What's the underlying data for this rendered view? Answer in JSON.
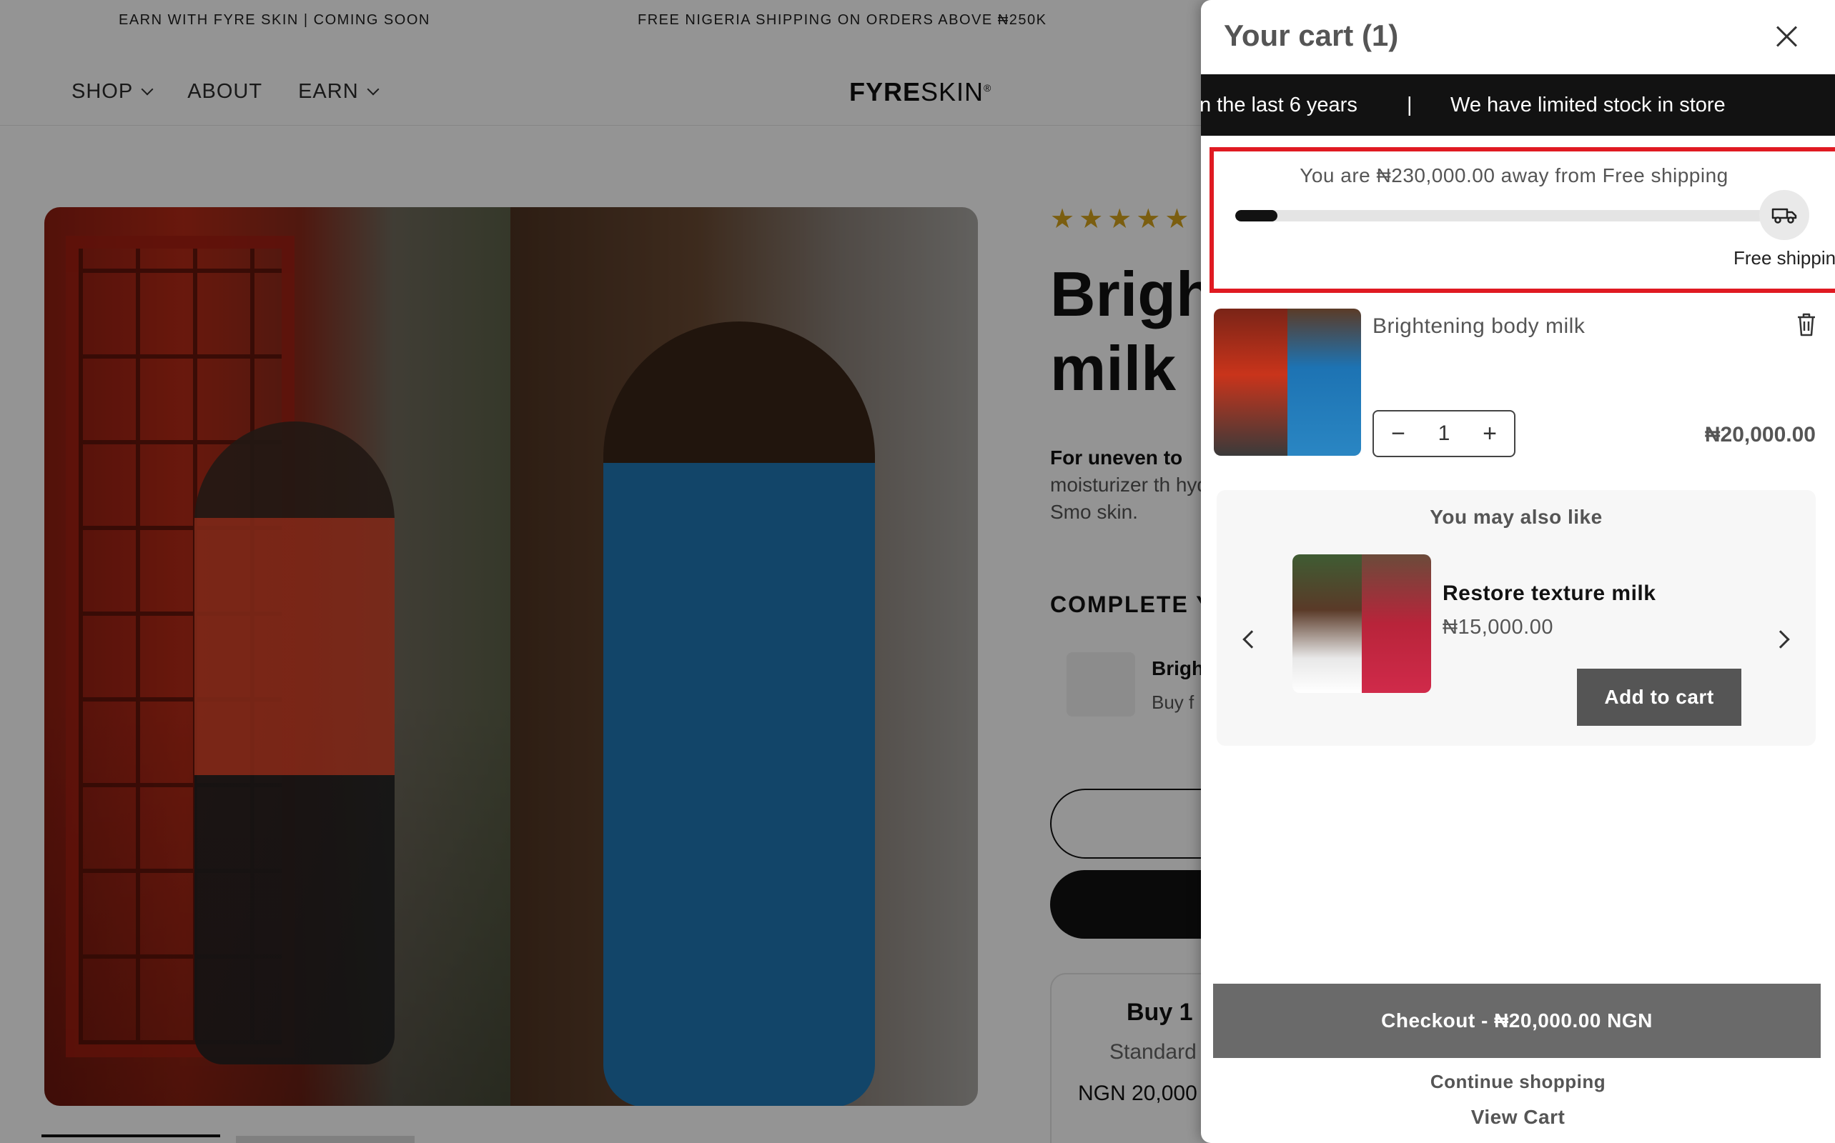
{
  "announcement": {
    "left": "EARN WITH FYRE SKIN | COMING SOON",
    "center": "FREE NIGERIA SHIPPING ON ORDERS ABOVE ₦250K"
  },
  "header": {
    "nav": [
      "SHOP",
      "ABOUT",
      "EARN"
    ],
    "logo_bold": "FYRE",
    "logo_light": "SKIN",
    "logo_mark": "®"
  },
  "product": {
    "title_line1": "Brigh",
    "title_line2": "milk",
    "desc_bold": "For uneven to",
    "desc_rest": "moisturizer th hydrates. Smo skin.",
    "complete_heading": "COMPLETE Y",
    "bundle_name": "Brigh",
    "bundle_sub": "Buy f",
    "offer_title": "Buy 1",
    "offer_standard": "Standard",
    "offer_price": "NGN 20,000"
  },
  "cart": {
    "title": "Your cart (1)",
    "marquee": {
      "text1": "n the last 6 years",
      "separator": "|",
      "text2": "We have limited stock in store"
    },
    "shipping": {
      "message": "You are ₦230,000.00 away from Free shipping",
      "progress_percent": 8,
      "label": "Free shipping"
    },
    "item": {
      "name": "Brightening body milk",
      "quantity": "1",
      "price": "₦20,000.00"
    },
    "upsell": {
      "title": "You may also like",
      "product_name": "Restore texture milk",
      "product_price": "₦15,000.00",
      "button": "Add to cart"
    },
    "checkout_label": "Checkout - ₦20,000.00 NGN",
    "continue_label": "Continue shopping",
    "view_cart_label": "View Cart"
  },
  "colors": {
    "highlight_border": "#e01a22",
    "marquee_bg": "#121212",
    "checkout_bg": "#6a6a6a",
    "star": "#d4a21c"
  },
  "icons": [
    "chevron-down-icon",
    "close-icon",
    "truck-icon",
    "trash-icon",
    "minus-icon",
    "plus-icon",
    "chevron-left-icon",
    "chevron-right-icon",
    "star-icon"
  ]
}
